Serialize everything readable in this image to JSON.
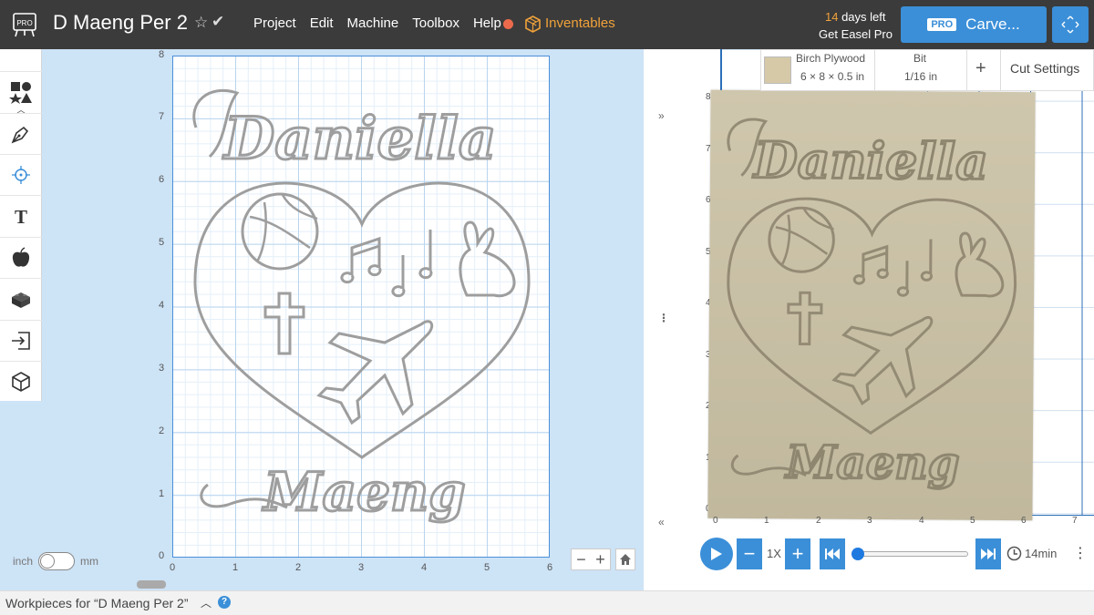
{
  "app": {
    "title": "D Maeng Per 2",
    "menu": [
      "Project",
      "Edit",
      "Machine",
      "Toolbox",
      "Help"
    ],
    "inventables_label": "Inventables",
    "trial_days": "14",
    "trial_suffix": " days left",
    "trial_cta": "Get Easel Pro",
    "pro_badge": "PRO",
    "carve_label": "Carve...",
    "logo_text": "PRO"
  },
  "toolbar": {
    "tools": [
      "shapes-icon",
      "pen-icon",
      "point-icon",
      "text-icon",
      "apple-icon",
      "brick-icon",
      "import-icon",
      "cube-icon"
    ]
  },
  "design": {
    "y_ticks": [
      "8",
      "7",
      "6",
      "5",
      "4",
      "3",
      "2",
      "1",
      "0"
    ],
    "x_ticks": [
      "0",
      "1",
      "2",
      "3",
      "4",
      "5",
      "6"
    ],
    "unit_left": "inch",
    "unit_right": "mm",
    "text_top": "Daniella",
    "text_bottom": "Maeng"
  },
  "preview": {
    "material_name": "Birch Plywood",
    "material_dims": "6 × 8 × 0.5 in",
    "bit_header": "Bit",
    "bit_value": "1/16 in",
    "cut_settings": "Cut Settings",
    "y_ticks": [
      "8",
      "7",
      "6",
      "5",
      "4",
      "3",
      "2",
      "1",
      "0"
    ],
    "x_ticks": [
      "0",
      "1",
      "2",
      "3",
      "4",
      "5",
      "6",
      "7"
    ],
    "speed": "1X",
    "time": "14min",
    "progress": 0
  },
  "footer": {
    "workpieces_label": "Workpieces for “D Maeng Per 2”"
  },
  "colors": {
    "accent": "#3b8fd8",
    "topbar": "#3b3b3b",
    "inventables": "#f0a23a",
    "record": "#ec6a4c"
  }
}
